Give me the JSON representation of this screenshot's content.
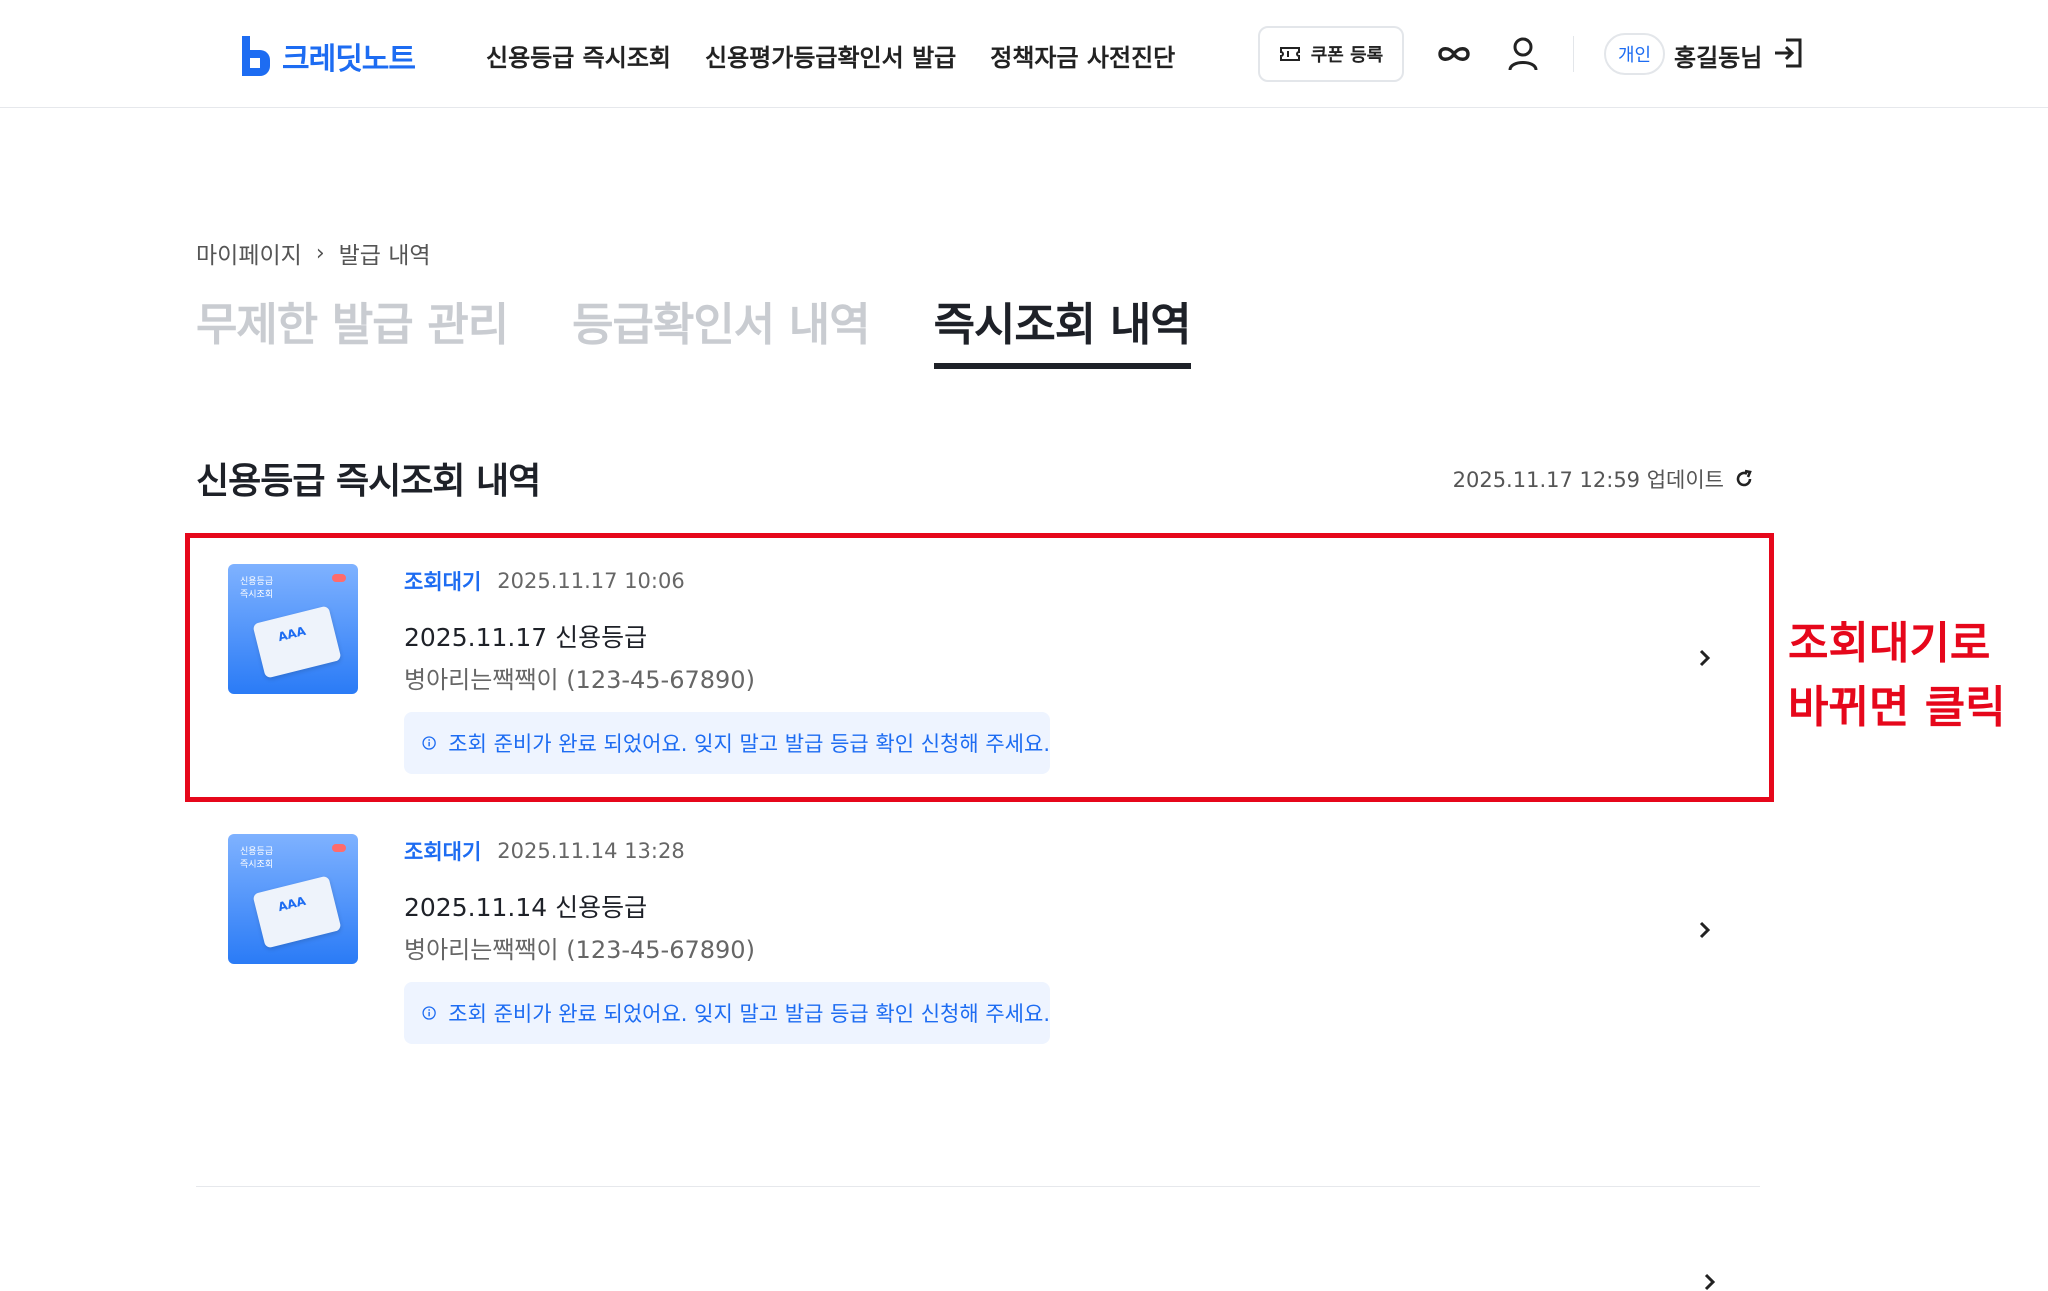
{
  "header": {
    "logo_text": "크레딧노트",
    "nav": [
      "신용등급 즉시조회",
      "신용평가등급확인서 발급",
      "정책자금 사전진단"
    ],
    "coupon_label": "쿠폰 등록",
    "personal_badge": "개인",
    "user_name": "홍길동님"
  },
  "breadcrumb": {
    "home": "마이페이지",
    "separator": "›",
    "current": "발급 내역"
  },
  "tabs": [
    "무제한 발급 관리",
    "등급확인서 내역",
    "즉시조회 내역"
  ],
  "section": {
    "title": "신용등급 즉시조회 내역",
    "updated": "2025.11.17 12:59 업데이트"
  },
  "items": [
    {
      "status": "조회대기",
      "date": "2025.11.17 10:06",
      "title": "2025.11.17 신용등급",
      "subtitle": "병아리는짹짹이 (123-45-67890)",
      "notice": "조회 준비가 완료 되었어요. 잊지 말고 발급 등급 확인 신청해 주세요.",
      "thumb_label": "신용등급\n즉시조회",
      "thumb_grade": "AAA"
    },
    {
      "status": "조회대기",
      "date": "2025.11.14 13:28",
      "title": "2025.11.14 신용등급",
      "subtitle": "병아리는짹짹이 (123-45-67890)",
      "notice": "조회 준비가 완료 되었어요. 잊지 말고 발급 등급 확인 신청해 주세요.",
      "thumb_label": "신용등급\n즉시조회",
      "thumb_grade": "AAA"
    }
  ],
  "annotation": {
    "line1": "조회대기로",
    "line2": "바뀌면 클릭"
  },
  "colors": {
    "brand": "#1d6cf2",
    "annotation": "#e6071b",
    "notice_bg": "#eef4ff"
  },
  "icons": {
    "coupon": "ticket-icon",
    "unlimited": "infinity-icon",
    "profile": "person-icon",
    "logout": "logout-icon",
    "refresh": "refresh-icon",
    "info": "info-icon",
    "chevron": "chevron-right-icon"
  }
}
